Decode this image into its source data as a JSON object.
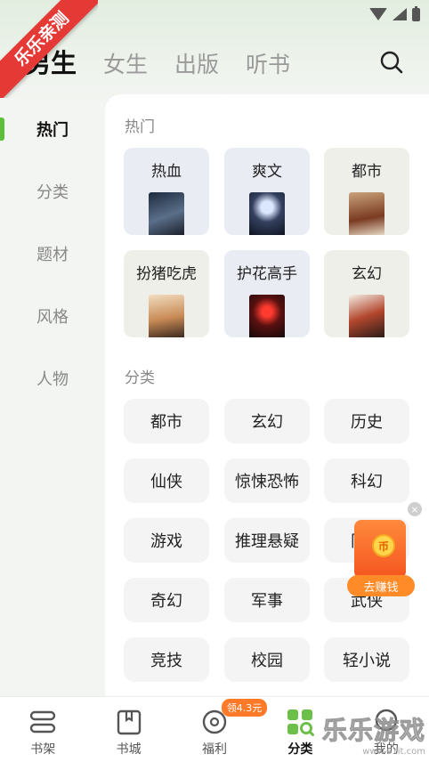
{
  "ribbon": {
    "text": "乐乐亲测"
  },
  "tabs": [
    {
      "label": "男生",
      "active": true
    },
    {
      "label": "女生",
      "active": false
    },
    {
      "label": "出版",
      "active": false
    },
    {
      "label": "听书",
      "active": false
    }
  ],
  "search": {
    "icon": "search-icon"
  },
  "side_nav": [
    {
      "label": "热门",
      "active": true
    },
    {
      "label": "分类",
      "active": false
    },
    {
      "label": "题材",
      "active": false
    },
    {
      "label": "风格",
      "active": false
    },
    {
      "label": "人物",
      "active": false
    }
  ],
  "hot": {
    "title": "热门",
    "items": [
      {
        "label": "热血"
      },
      {
        "label": "爽文"
      },
      {
        "label": "都市"
      },
      {
        "label": "扮猪吃虎"
      },
      {
        "label": "护花高手"
      },
      {
        "label": "玄幻"
      }
    ]
  },
  "category": {
    "title": "分类",
    "items": [
      {
        "label": "都市"
      },
      {
        "label": "玄幻"
      },
      {
        "label": "历史"
      },
      {
        "label": "仙侠"
      },
      {
        "label": "惊悚恐怖"
      },
      {
        "label": "科幻"
      },
      {
        "label": "游戏"
      },
      {
        "label": "推理悬疑"
      },
      {
        "label": "同人"
      },
      {
        "label": "奇幻"
      },
      {
        "label": "军事"
      },
      {
        "label": "武侠"
      },
      {
        "label": "竞技"
      },
      {
        "label": "校园"
      },
      {
        "label": "轻小说"
      }
    ]
  },
  "float_ad": {
    "coin": "币",
    "button": "去赚钱",
    "close": "×"
  },
  "bottom_nav": [
    {
      "label": "书架",
      "icon": "bookshelf-icon",
      "active": false
    },
    {
      "label": "书城",
      "icon": "bookstore-icon",
      "active": false
    },
    {
      "label": "福利",
      "icon": "welfare-icon",
      "active": false,
      "badge": "领4.3元"
    },
    {
      "label": "分类",
      "icon": "category-icon",
      "active": true
    },
    {
      "label": "我的",
      "icon": "profile-icon",
      "active": false
    }
  ],
  "watermark": {
    "main": "乐乐游戏",
    "sub": "www.61it.com"
  },
  "colors": {
    "accent": "#5cbf3a",
    "ribbon": "#e53935",
    "float": "#ff8a28"
  }
}
